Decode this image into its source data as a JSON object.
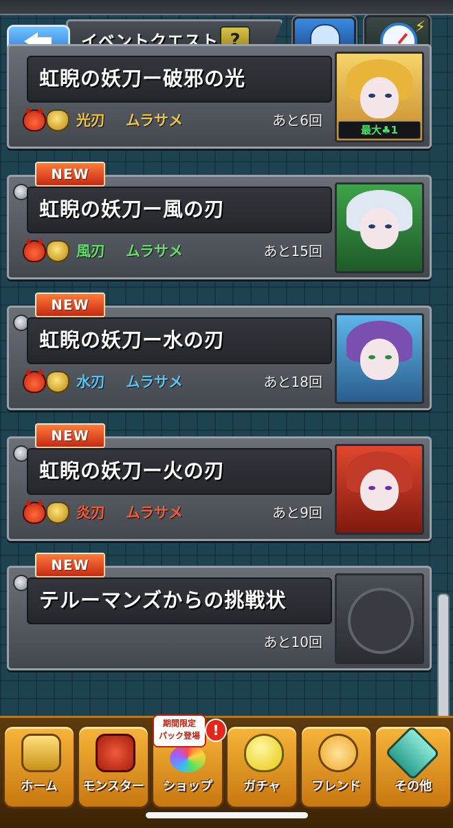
{
  "header": {
    "title": "イベントクエスト",
    "help_label": "?"
  },
  "quests": [
    {
      "name": "虹睨の妖刀ー破邪の光",
      "element": "光刃",
      "monster": "ムラサメ",
      "remaining": "あと6回",
      "is_new": false,
      "element_color": "#f0c63a",
      "max_badge": "最大♣1"
    },
    {
      "name": "虹睨の妖刀ー風の刃",
      "element": "風刃",
      "monster": "ムラサメ",
      "remaining": "あと15回",
      "is_new": true,
      "element_color": "#5fe36a"
    },
    {
      "name": "虹睨の妖刀ー水の刃",
      "element": "水刃",
      "monster": "ムラサメ",
      "remaining": "あと18回",
      "is_new": true,
      "element_color": "#52c9f5"
    },
    {
      "name": "虹睨の妖刀ー火の刃",
      "element": "炎刃",
      "monster": "ムラサメ",
      "remaining": "あと9回",
      "is_new": true,
      "element_color": "#ff5a2e"
    },
    {
      "name": "テルーマンズからの挑戦状",
      "element": "",
      "monster": "",
      "remaining": "あと10回",
      "is_new": true,
      "element_color": "#ffffff"
    }
  ],
  "new_label": "NEW",
  "nav": {
    "tabs": [
      {
        "label": "ホーム",
        "icon": "home-gate-icon"
      },
      {
        "label": "モンスター",
        "icon": "dragon-icon"
      },
      {
        "label": "ショップ",
        "icon": "rainbow-orb-icon"
      },
      {
        "label": "ガチャ",
        "icon": "gacha-egg-icon"
      },
      {
        "label": "フレンド",
        "icon": "friends-balloon-icon"
      },
      {
        "label": "その他",
        "icon": "other-menu-icon"
      }
    ],
    "shop_badge_line1": "期間限定",
    "shop_badge_line2": "パック登場",
    "alert_label": "!"
  }
}
